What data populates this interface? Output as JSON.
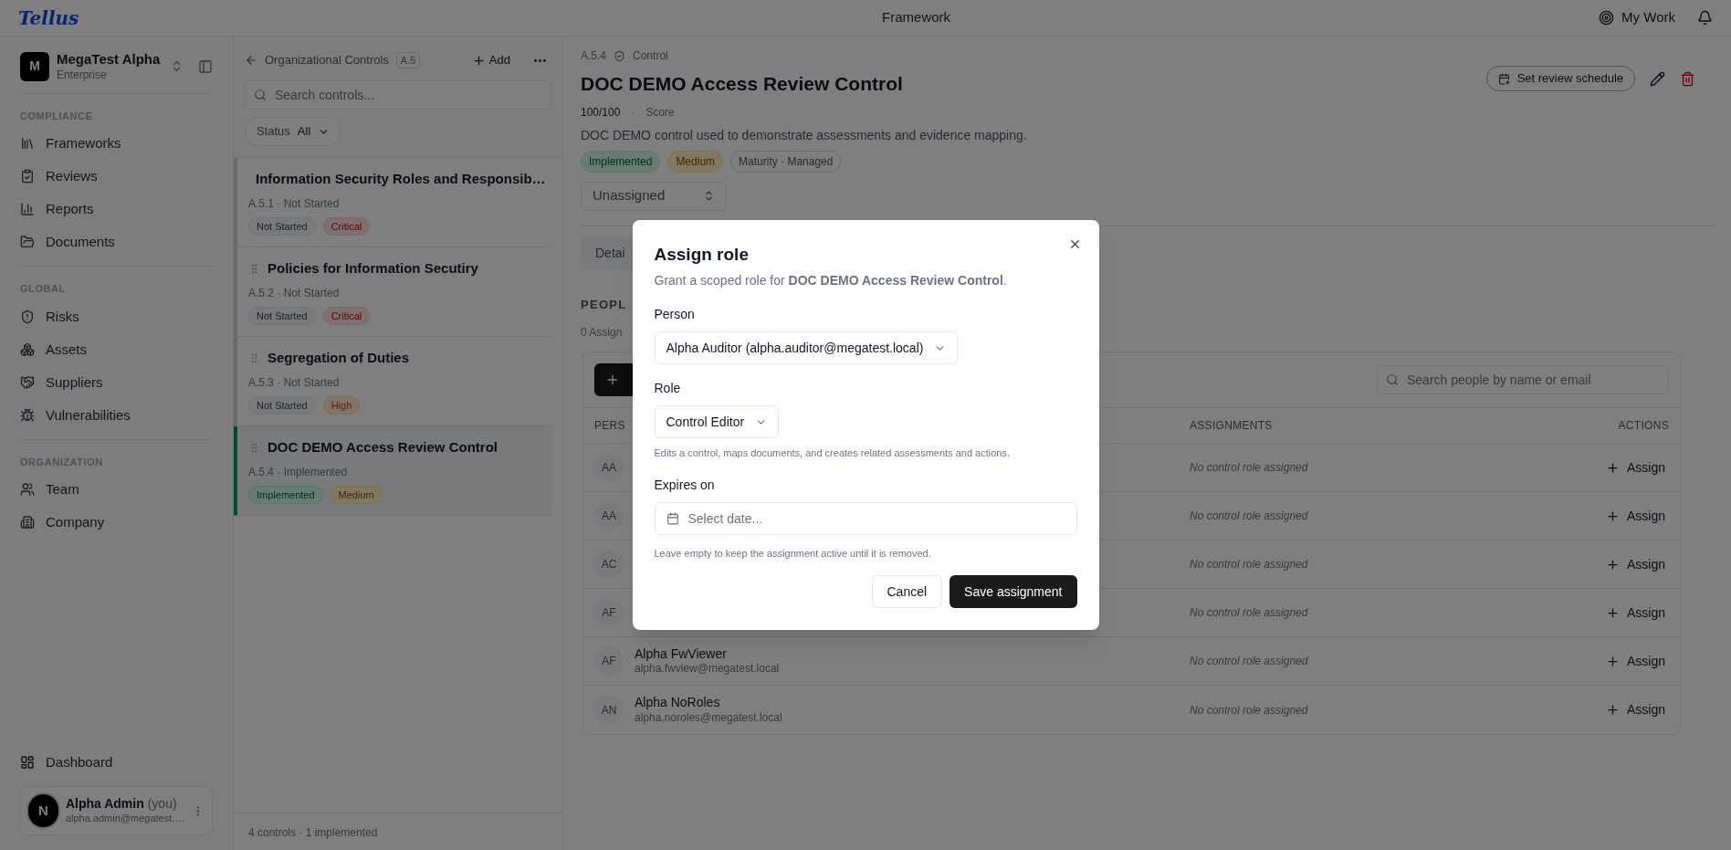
{
  "header": {
    "logo": "Tellus",
    "title": "Framework",
    "my_work": "My Work"
  },
  "org": {
    "initial": "M",
    "name": "MegaTest Alpha",
    "plan": "Enterprise"
  },
  "nav_sections": [
    {
      "label": "COMPLIANCE",
      "items": [
        "Frameworks",
        "Reviews",
        "Reports",
        "Documents"
      ]
    },
    {
      "label": "GLOBAL",
      "items": [
        "Risks",
        "Assets",
        "Suppliers",
        "Vulnerabilities"
      ]
    },
    {
      "label": "ORGANIZATION",
      "items": [
        "Team",
        "Company"
      ]
    }
  ],
  "dashboard": "Dashboard",
  "user": {
    "initial": "N",
    "name": "Alpha Admin",
    "you": "(you)",
    "email": "alpha.admin@megatest.…"
  },
  "controls": {
    "back_label": "Organizational Controls",
    "code": "A.5",
    "add": "Add",
    "search_placeholder": "Search controls...",
    "filter_label": "Status",
    "filter_value": "All",
    "items": [
      {
        "title": "Information Security Roles and Responsib…",
        "meta": "A.5.1 · Not Started",
        "selected": false,
        "badges": [
          {
            "label": "Not Started",
            "kind": "neutral"
          },
          {
            "label": "Critical",
            "kind": "critical"
          }
        ]
      },
      {
        "title": "Policies for Information Secutiry",
        "meta": "A.5.2 · Not Started",
        "selected": false,
        "badges": [
          {
            "label": "Not Started",
            "kind": "neutral"
          },
          {
            "label": "Critical",
            "kind": "critical"
          }
        ]
      },
      {
        "title": "Segregation of Duties",
        "meta": "A.5.3 · Not Started",
        "selected": false,
        "badges": [
          {
            "label": "Not Started",
            "kind": "neutral"
          },
          {
            "label": "High",
            "kind": "high"
          }
        ]
      },
      {
        "title": "DOC DEMO Access Review Control",
        "meta": "A.5.4 · Implemented",
        "selected": true,
        "badges": [
          {
            "label": "Implemented",
            "kind": "success"
          },
          {
            "label": "Medium",
            "kind": "medium"
          }
        ]
      }
    ],
    "footer": "4 controls · 1 implemented"
  },
  "detail": {
    "code": "A.5.4",
    "type": "Control",
    "title": "DOC DEMO Access Review Control",
    "score": "100/100",
    "score_separator": "·",
    "score_label": "Score",
    "description": "DOC DEMO control used to demonstrate assessments and evidence mapping.",
    "badges": [
      {
        "label": "Implemented",
        "kind": "success"
      },
      {
        "label": "Medium",
        "kind": "medium"
      },
      {
        "label": "Maturity · Managed",
        "kind": "outline"
      }
    ],
    "owner": "Unassigned",
    "schedule_button": "Set review schedule",
    "tab": "Detai",
    "people_heading": "PEOPL",
    "people_count": "0 Assign",
    "table": {
      "search_placeholder": "Search people by name or email",
      "columns": [
        "PERS",
        "ASSIGNMENTS",
        "ACTIONS"
      ],
      "rows": [
        {
          "initials": "AA",
          "assignment": "No control role assigned",
          "action": "Assign"
        },
        {
          "initials": "AA",
          "assignment": "No control role assigned",
          "action": "Assign"
        },
        {
          "initials": "AC",
          "assignment": "No control role assigned",
          "action": "Assign"
        },
        {
          "initials": "AF",
          "assignment": "No control role assigned",
          "action": "Assign"
        },
        {
          "initials": "AF",
          "name": "Alpha FwViewer",
          "email": "alpha.fwview@megatest.local",
          "assignment": "No control role assigned",
          "action": "Assign"
        },
        {
          "initials": "AN",
          "name": "Alpha NoRoles",
          "email": "alpha.noroles@megatest.local",
          "assignment": "No control role assigned",
          "action": "Assign"
        }
      ]
    }
  },
  "modal": {
    "title": "Assign role",
    "description": "Grant a scoped role for **DOC DEMO Access Review Control**.",
    "person_label": "Person",
    "person_value": "Alpha Auditor (alpha.auditor@megatest.local)",
    "role_label": "Role",
    "role_value": "Control Editor",
    "role_help": "Edits a control, maps documents, and creates related assessments and actions.",
    "expires_label": "Expires on",
    "expires_placeholder": "Select date...",
    "expires_help": "Leave empty to keep the assignment active until it is removed.",
    "cancel": "Cancel",
    "save": "Save assignment"
  }
}
